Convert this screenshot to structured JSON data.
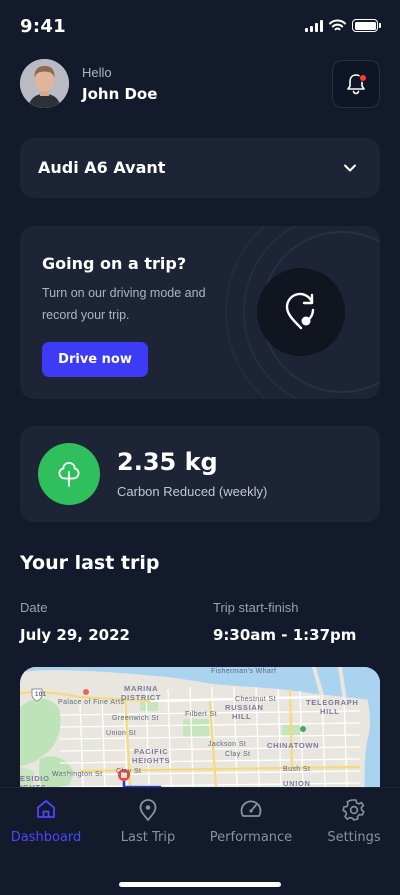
{
  "status_bar": {
    "time": "9:41"
  },
  "header": {
    "greeting": "Hello",
    "user_name": "John Doe"
  },
  "vehicle": {
    "selected": "Audi A6 Avant"
  },
  "trip_prompt": {
    "title": "Going on a trip?",
    "description": "Turn on our driving mode and record your trip.",
    "button_label": "Drive now"
  },
  "carbon": {
    "value": "2.35 kg",
    "label": "Carbon Reduced (weekly)"
  },
  "last_trip": {
    "title": "Your last trip",
    "date_label": "Date",
    "date_value": "July 29, 2022",
    "time_label": "Trip start-finish",
    "time_value": "9:30am - 1:37pm"
  },
  "map": {
    "labels": {
      "fishermans_wharf": "Fisherman's Wharf",
      "marina": "MARINA",
      "district": "DISTRICT",
      "palace": "Palace of Fine Arts",
      "chestnut": "Chestnut St",
      "telegraph": "TELEGRAPH",
      "hill": "HILL",
      "greenwich": "Greenwich St",
      "filbert": "Filbert St",
      "russian": "RUSSIAN",
      "union": "Union St",
      "pacific": "PACIFIC",
      "heights": "HEIGHTS",
      "jackson": "Jackson St",
      "clay": "Clay St",
      "chinatown": "CHINATOWN",
      "washington": "Washington St",
      "presidio": "ESIDIO",
      "heights_partial": "IGHTS",
      "bush": "Bush St",
      "union_square": "UNION",
      "highway": "101"
    }
  },
  "tabs": [
    {
      "label": "Dashboard",
      "icon": "home-icon",
      "active": true
    },
    {
      "label": "Last Trip",
      "icon": "location-pin-icon",
      "active": false
    },
    {
      "label": "Performance",
      "icon": "speedometer-icon",
      "active": false
    },
    {
      "label": "Settings",
      "icon": "gear-icon",
      "active": false
    }
  ],
  "colors": {
    "background": "#121a2b",
    "card": "#1c2435",
    "accent": "#3d3bf5",
    "eco_green": "#2fbf5c",
    "notification": "#ff3b30"
  }
}
